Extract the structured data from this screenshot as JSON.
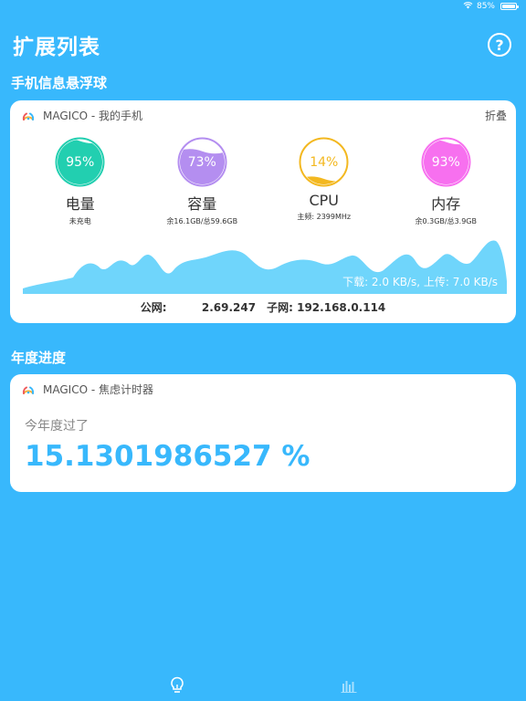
{
  "status_bar": {
    "battery": "85%",
    "battery_level": 0.85
  },
  "header": {
    "title": "扩展列表",
    "help_label": "?"
  },
  "section1": {
    "title": "手机信息悬浮球"
  },
  "phone_card": {
    "app_name": "MAGICO - 我的手机",
    "collapse_label": "折叠",
    "metrics": [
      {
        "value": "95%",
        "label": "电量",
        "sub": "未充电",
        "color_top": "#41e0c5",
        "color_bottom": "#22cfb0",
        "fill": 0.95
      },
      {
        "value": "73%",
        "label": "容量",
        "sub": "余16.1GB/总59.6GB",
        "color_top": "#c9a7f5",
        "color_bottom": "#b48ef0",
        "fill": 0.73
      },
      {
        "value": "14%",
        "label": "CPU",
        "sub": "主频: 2399MHz",
        "color_top": "#f8c531",
        "color_bottom": "#f3b820",
        "fill": 0.14
      },
      {
        "value": "93%",
        "label": "内存",
        "sub": "余0.3GB/总3.9GB",
        "color_top": "#fb8df5",
        "color_bottom": "#f770ef",
        "fill": 0.93
      }
    ],
    "speed": "下载: 2.0 KB/s, 上传: 7.0 KB/s",
    "public_ip_label": "公网:",
    "public_ip": "2.69.247",
    "lan_ip_label": "子网:",
    "lan_ip": "192.168.0.114"
  },
  "section2": {
    "title": "年度进度"
  },
  "progress_card": {
    "app_name": "MAGICO - 焦虑计时器",
    "label": "今年度过了",
    "value": "15.1301986527 %"
  },
  "tabs": [
    {
      "name": "extensions-tab",
      "icon": "lightbulb-icon"
    },
    {
      "name": "stats-tab",
      "icon": "bar-chart-icon"
    }
  ],
  "colors": {
    "background": "#38b8fc",
    "accent": "#38b8fc",
    "wave": "#6fd5fb"
  }
}
